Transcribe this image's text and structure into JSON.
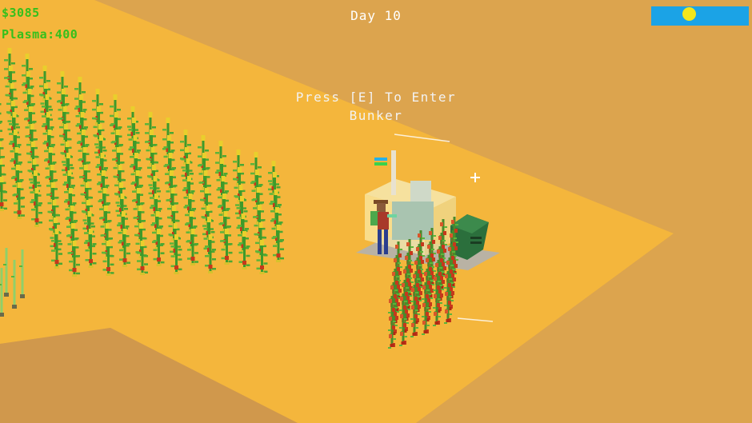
{
  "hud": {
    "money": "$3085",
    "plasma": "Plasma:400",
    "day": "Day 10",
    "prompt": "Press [E] To Enter\nBunker"
  },
  "day_cycle": {
    "sun_icon": "sun-icon",
    "sky_color": "#1ba3e6",
    "sun_color": "#f3e61a"
  },
  "colors": {
    "ground_dark": "#dca44e",
    "ground_light": "#f4b63c",
    "ground_shade": "#c9944c",
    "stalk": "#3e9a2a",
    "crop_fruit": "#c6381c",
    "bunker_wall": "#fbe9a5",
    "tank": "#2b6f3c",
    "hud_text": "#34c01c"
  }
}
